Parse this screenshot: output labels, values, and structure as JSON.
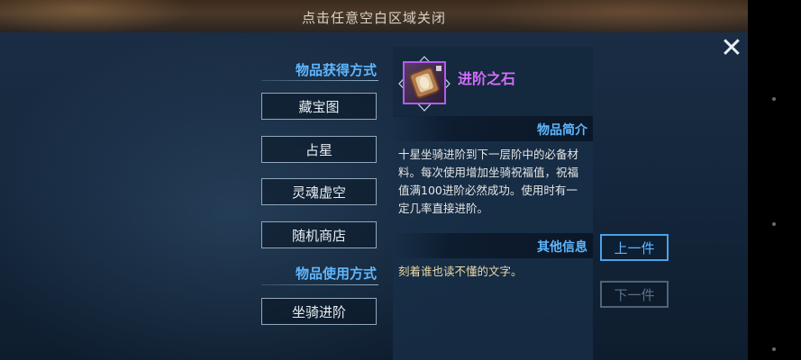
{
  "hint": "点击任意空白区域关闭",
  "close_icon": "close-icon",
  "sections": {
    "obtain_title": "物品获得方式",
    "obtain_buttons": [
      "藏宝图",
      "占星",
      "灵魂虚空",
      "随机商店"
    ],
    "use_title": "物品使用方式",
    "use_buttons": [
      "坐骑进阶"
    ]
  },
  "item": {
    "name": "进阶之石",
    "icon": "advance-stone-icon",
    "rarity_color": "#b35cf0",
    "intro_label": "物品简介",
    "description": "十星坐骑进阶到下一层阶中的必备材\n料。每次使用增加坐骑祝福值，祝福\n值满100进阶必然成功。使用时有一\n定几率直接进阶。",
    "other_label": "其他信息",
    "other_text": "刻着谁也读不懂的文字。"
  },
  "nav": {
    "prev_label": "上一件",
    "next_label": "下一件"
  },
  "colors": {
    "accent": "#5fb7ff",
    "item_name": "#d46cff",
    "other_text": "#ead9a8"
  }
}
